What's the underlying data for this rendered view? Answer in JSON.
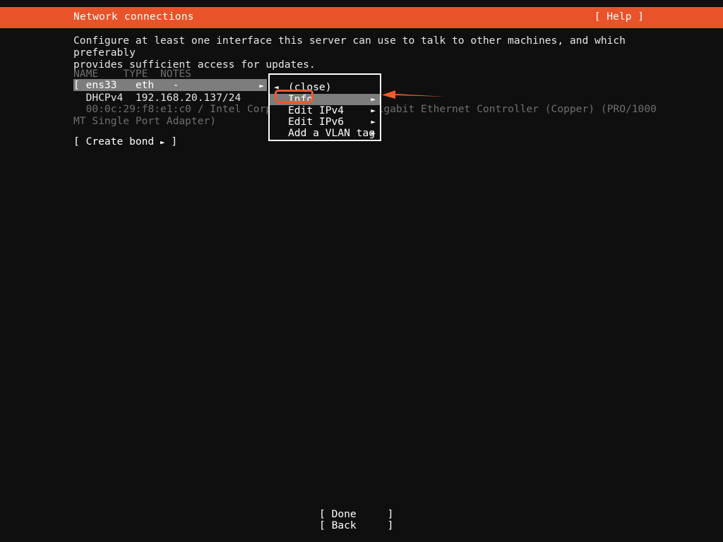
{
  "header": {
    "title": "Network connections",
    "help_label": "[ Help ]",
    "bar_color": "#e8532a"
  },
  "intro": {
    "text": "Configure at least one interface this server can use to talk to other machines, and which preferably\nprovides sufficient access for updates."
  },
  "table": {
    "columns_line": "NAME    TYPE  NOTES",
    "columns": [
      "NAME",
      "TYPE",
      "NOTES"
    ],
    "selected_row_text": "[ ens33   eth   -",
    "selected_row_caret": "►",
    "interface": {
      "name": "ens33",
      "type": "eth",
      "notes": "-",
      "dhcp_line": "  DHCPv4  192.168.20.137/24",
      "description": "  00:0c:29:f8:e1:c0 / Intel Corporation 82545EM Gigabit Ethernet Controller (Copper) (PRO/1000 MT Single Port Adapter)"
    }
  },
  "create_bond": {
    "prefix": "[ Create bond ",
    "caret": "►",
    "suffix": " ]"
  },
  "popup_menu": {
    "items": [
      {
        "label": "(close)",
        "left_caret": "◄",
        "right_caret": "",
        "selected": false
      },
      {
        "label": "Info",
        "left_caret": "",
        "right_caret": "►",
        "selected": true
      },
      {
        "label": "Edit IPv4",
        "left_caret": "",
        "right_caret": "►",
        "selected": false
      },
      {
        "label": "Edit IPv6",
        "left_caret": "",
        "right_caret": "►",
        "selected": false
      },
      {
        "label": "Add a VLAN tag",
        "left_caret": "",
        "right_caret": "►",
        "selected": false
      }
    ]
  },
  "annotations": {
    "highlight_color": "#ef5b28",
    "arrow_color": "#ef5b28"
  },
  "footer": {
    "done_label": "[ Done     ]",
    "back_label": "[ Back     ]"
  }
}
